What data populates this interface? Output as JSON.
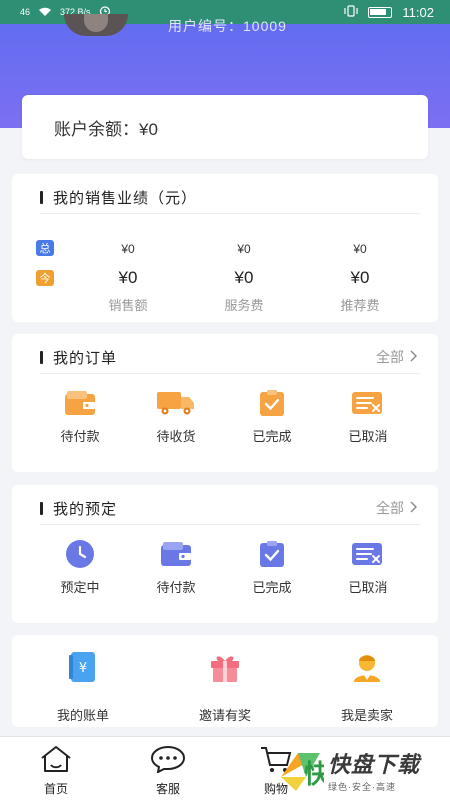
{
  "status_bar": {
    "signal": "46",
    "speed": "372 B/s",
    "time": "11:02"
  },
  "header": {
    "user_id": "用户编号：10009"
  },
  "balance": {
    "label": "账户余额：¥0"
  },
  "sales": {
    "title": "我的销售业绩（元）",
    "badge_total": "总",
    "badge_today": "今",
    "columns": [
      {
        "total": "¥0",
        "today": "¥0",
        "label": "销售额"
      },
      {
        "total": "¥0",
        "today": "¥0",
        "label": "服务费"
      },
      {
        "total": "¥0",
        "today": "¥0",
        "label": "推荐费"
      }
    ]
  },
  "orders": {
    "title": "我的订单",
    "more": "全部",
    "items": [
      {
        "label": "待付款",
        "icon": "wallet-icon"
      },
      {
        "label": "待收货",
        "icon": "truck-icon"
      },
      {
        "label": "已完成",
        "icon": "check-doc-icon"
      },
      {
        "label": "已取消",
        "icon": "cancel-doc-icon"
      }
    ]
  },
  "reserve": {
    "title": "我的预定",
    "more": "全部",
    "items": [
      {
        "label": "预定中",
        "icon": "clock-icon"
      },
      {
        "label": "待付款",
        "icon": "wallet-icon"
      },
      {
        "label": "已完成",
        "icon": "check-doc-icon"
      },
      {
        "label": "已取消",
        "icon": "cancel-doc-icon"
      }
    ]
  },
  "tools": {
    "items": [
      {
        "label": "我的账单",
        "icon": "bill-icon"
      },
      {
        "label": "邀请有奖",
        "icon": "gift-icon"
      },
      {
        "label": "我是卖家",
        "icon": "seller-icon"
      }
    ]
  },
  "nav": {
    "home": "首页",
    "service": "客服",
    "cart": "购物"
  },
  "watermark": {
    "big": "快盘下载",
    "small": "绿色·安全·高速"
  },
  "colors": {
    "header_start": "#5c6cf0",
    "header_end": "#7d6ff2",
    "orange": "#f0a030",
    "blue": "#4a7ae8",
    "reserve_icon": "#6a78e6"
  }
}
